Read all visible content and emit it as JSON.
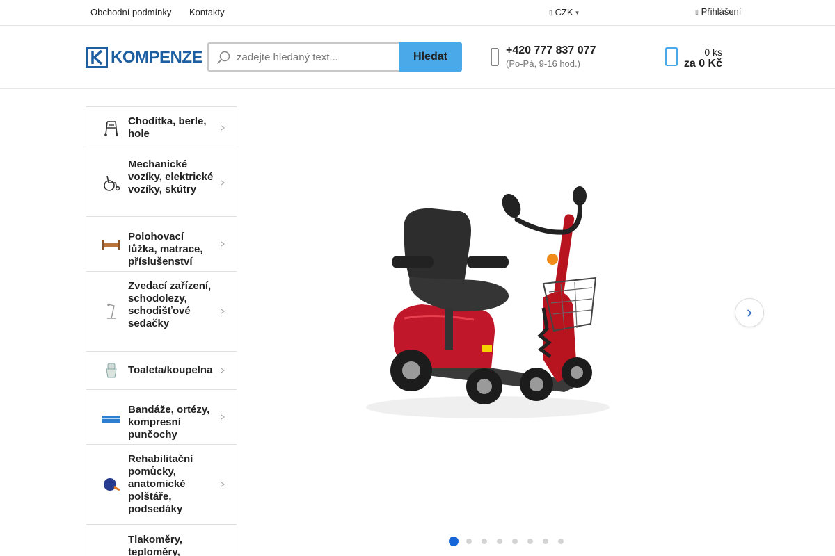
{
  "topbar": {
    "links": [
      "Obchodní podmínky",
      "Kontakty"
    ],
    "currency": "CZK",
    "login": "Přihlášení"
  },
  "header": {
    "logo_text": "KOMPENZE",
    "search": {
      "placeholder": "zadejte hledaný text...",
      "button_label": "Hledat"
    },
    "phone": {
      "number": "+420 777 837 077",
      "hours": "(Po-Pá, 9-16 hod.)"
    },
    "cart": {
      "quantity": "0 ks",
      "total": "za 0 Kč"
    }
  },
  "categories": [
    {
      "label": "Chodítka, berle, hole",
      "icon": "walker-icon"
    },
    {
      "label": "Mechanické vozíky, elektrické vozíky, skútry",
      "icon": "wheelchair-icon"
    },
    {
      "label": "Polohovací lůžka, matrace, příslušenství",
      "icon": "bed-icon"
    },
    {
      "label": "Zvedací zařízení, schodolezy, schodišťové sedačky",
      "icon": "lift-icon"
    },
    {
      "label": "Toaleta/koupelna",
      "icon": "toilet-icon"
    },
    {
      "label": "Bandáže, ortézy, kompresní punčochy",
      "icon": "bandage-icon"
    },
    {
      "label": "Rehabilitační pomůcky, anatomické polštáře, podsedáky",
      "icon": "rehab-ball-icon"
    },
    {
      "label": "Tlakoměry, teploměry,",
      "icon": ""
    }
  ],
  "carousel": {
    "slide_count": 8,
    "active_slide": 1
  },
  "colors": {
    "brand": "#1d5fa0",
    "search_button": "#4aa9e9",
    "active_dot": "#1565d8"
  }
}
